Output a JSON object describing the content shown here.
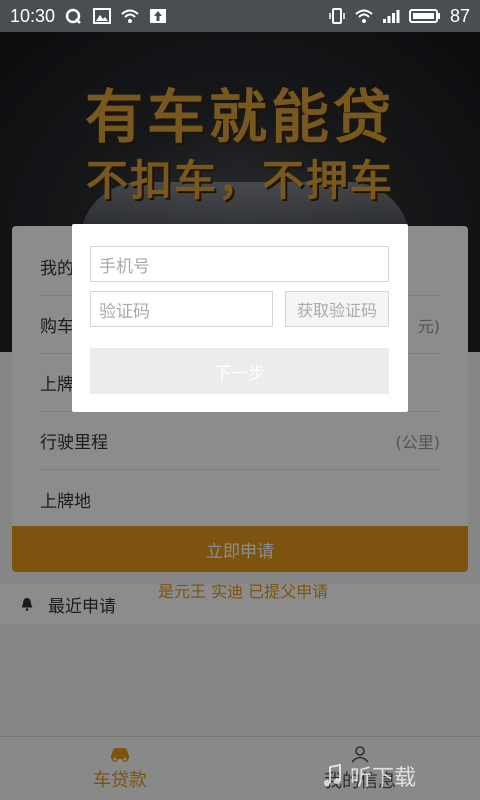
{
  "status_bar": {
    "time": "10:30",
    "battery": "87",
    "left_icons": [
      "q-icon",
      "image-icon",
      "wifi-icon",
      "upload-icon"
    ],
    "right_icons": [
      "vibrate-icon",
      "wifi-icon",
      "signal-4g-icon",
      "battery-icon"
    ]
  },
  "banner": {
    "headline": "有车就能贷",
    "subline": "不扣车，不押车"
  },
  "form": {
    "rows": [
      {
        "label": "我的",
        "unit": ""
      },
      {
        "label": "购车",
        "unit": "元)"
      },
      {
        "label": "上牌",
        "unit": ""
      },
      {
        "label": "行驶里程",
        "unit": "(公里)"
      },
      {
        "label": "上牌地",
        "unit": ""
      }
    ],
    "apply_button": "立即申请"
  },
  "recent": {
    "label": "最近申请",
    "ticker": " 是元王 实迪 已提父申请"
  },
  "tabs": [
    {
      "label": "车贷款",
      "icon": "car-icon",
      "active": true
    },
    {
      "label": "我的信息",
      "icon": "user-icon",
      "active": false
    }
  ],
  "dialog": {
    "phone_placeholder": "手机号",
    "code_placeholder": "验证码",
    "get_code_button": "获取验证码",
    "next_button": "下一步"
  },
  "watermark": "听下载",
  "colors": {
    "accent": "#e39a1c",
    "status_bar": "#4a4d52"
  }
}
